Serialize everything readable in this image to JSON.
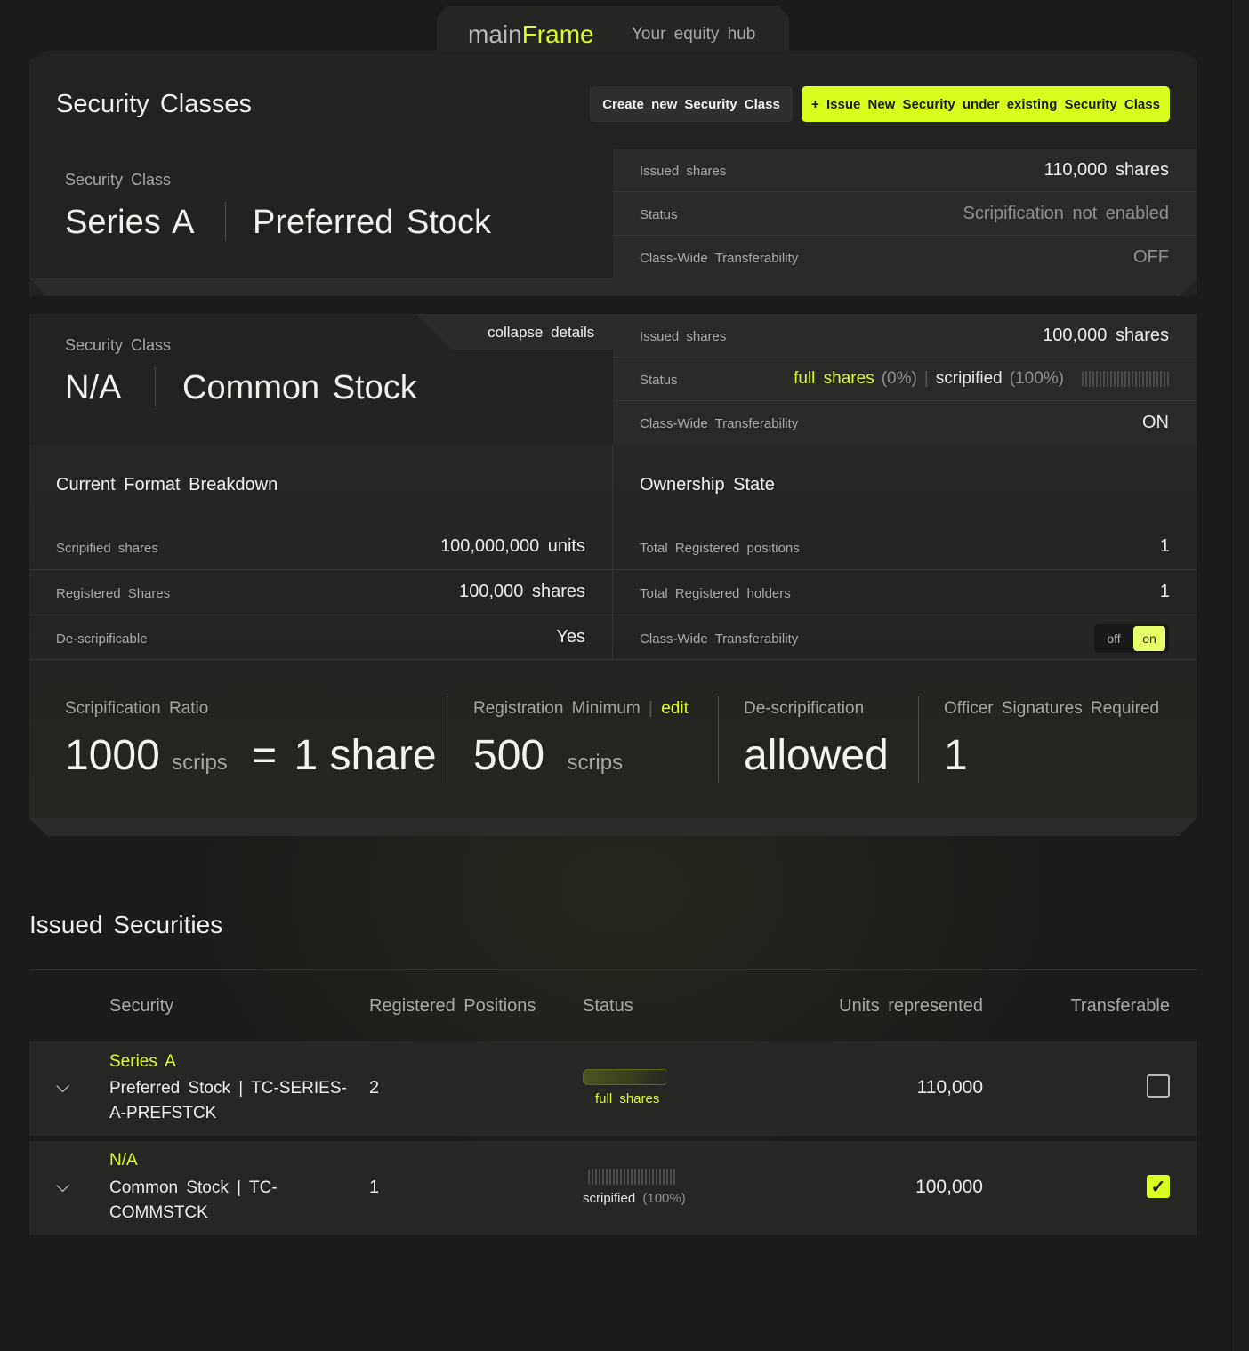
{
  "brand": {
    "name_plain": "main",
    "name_accent": "Frame",
    "tagline": "Your equity hub"
  },
  "security_classes": {
    "title": "Security Classes",
    "create_button": "Create new Security Class",
    "issue_button": "+ Issue New Security under existing Security Class",
    "classes": [
      {
        "label": "Security Class",
        "series": "Series A",
        "type": "Preferred Stock",
        "issued_label": "Issued shares",
        "issued_value": "110,000 shares",
        "status_label": "Status",
        "status_value": "Scripification not enabled",
        "transfer_label": "Class-Wide Transferability",
        "transfer_value": "OFF"
      },
      {
        "label": "Security Class",
        "series": "N/A",
        "type": "Common Stock",
        "collapse_label": "collapse details",
        "issued_label": "Issued shares",
        "issued_value": "100,000 shares",
        "status_label": "Status",
        "status_full": "full shares",
        "status_full_pct": "(0%)",
        "status_sep": "|",
        "status_scrip": "scripified",
        "status_scrip_pct": "(100%)",
        "transfer_label": "Class-Wide Transferability",
        "transfer_value": "ON"
      }
    ]
  },
  "breakdown": {
    "title": "Current Format Breakdown",
    "rows": [
      {
        "label": "Scripified shares",
        "value": "100,000,000 units"
      },
      {
        "label": "Registered Shares",
        "value": "100,000 shares"
      },
      {
        "label": "De-scripificable",
        "value": "Yes"
      }
    ]
  },
  "ownership": {
    "title": "Ownership State",
    "rows": [
      {
        "label": "Total Registered positions",
        "value": "1"
      },
      {
        "label": "Total Registered holders",
        "value": "1"
      },
      {
        "label": "Class-Wide Transferability",
        "toggle_off": "off",
        "toggle_on": "on"
      }
    ]
  },
  "stats": {
    "ratio_label": "Scripification Ratio",
    "ratio_left": "1000",
    "ratio_left_unit": "scrips",
    "ratio_eq": "=",
    "ratio_right": "1 share",
    "regmin_label": "Registration Minimum",
    "regmin_sep": "|",
    "regmin_edit": "edit",
    "regmin_value": "500",
    "regmin_unit": "scrips",
    "descrip_label": "De-scripification",
    "descrip_value": "allowed",
    "officer_label": "Officer Signatures Required",
    "officer_value": "1"
  },
  "issued": {
    "title": "Issued Securities",
    "headers": [
      "Security",
      "Registered Positions",
      "Status",
      "Units represented",
      "Transferable"
    ],
    "rows": [
      {
        "title": "Series A",
        "name": "Preferred Stock | TC-SERIES-A-PREFSTCK",
        "positions": "2",
        "status": "full shares",
        "status_pct": "",
        "units": "110,000",
        "transferable": false
      },
      {
        "title": "N/A",
        "name": "Common Stock | TC-COMMSTCK",
        "positions": "1",
        "status": "scripified",
        "status_pct": "(100%)",
        "units": "100,000",
        "transferable": true
      }
    ]
  },
  "colors": {
    "accent": "#d9ff1f",
    "background": "#1a1a19",
    "panel": "#222321"
  }
}
